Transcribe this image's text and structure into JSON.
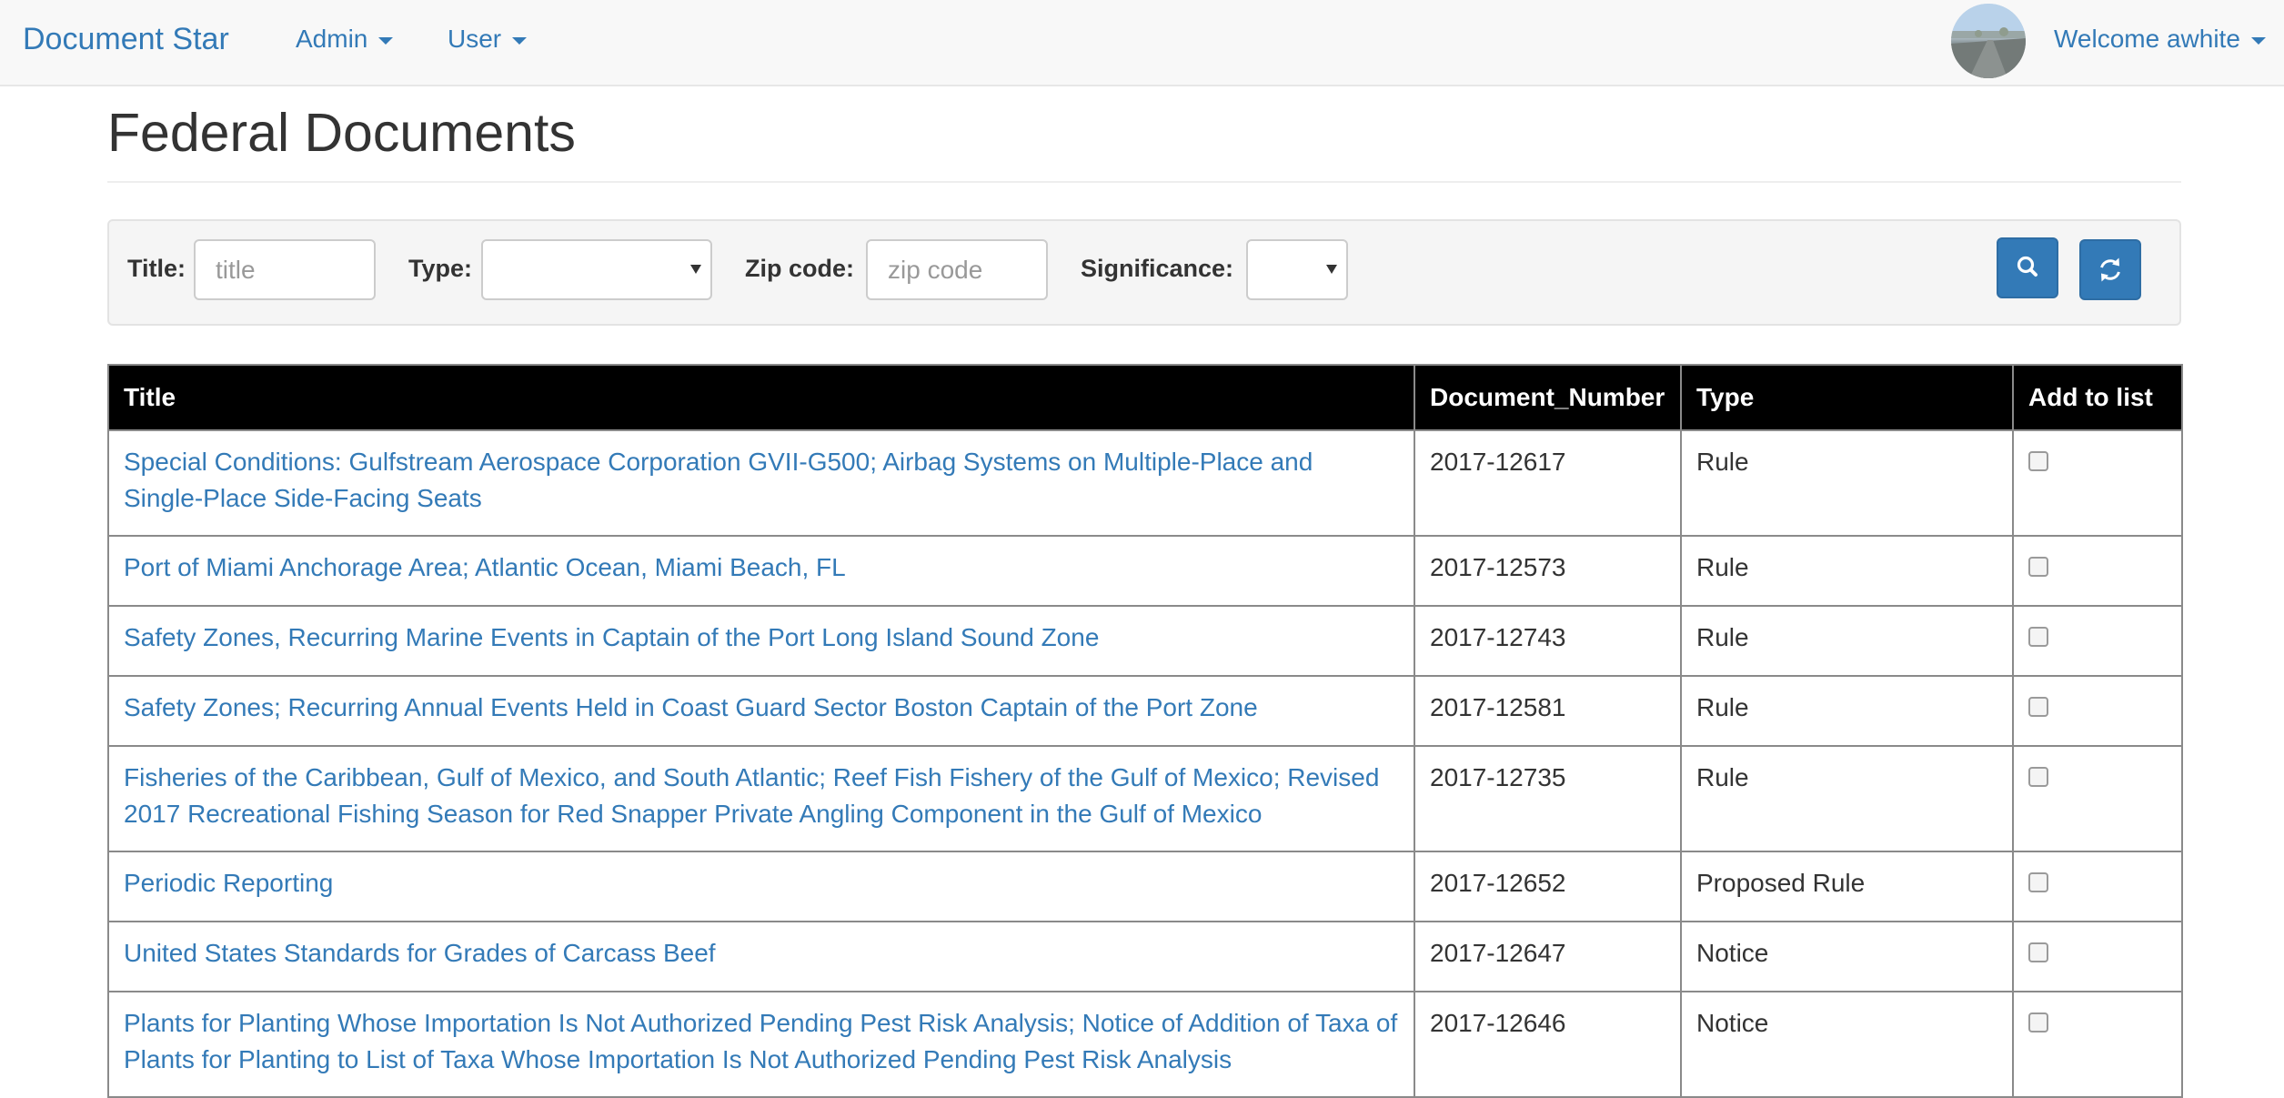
{
  "navbar": {
    "brand": "Document Star",
    "admin_label": "Admin",
    "user_label": "User",
    "welcome_label": "Welcome awhite"
  },
  "page": {
    "title": "Federal Documents"
  },
  "filters": {
    "title_label": "Title:",
    "title_placeholder": "title",
    "title_value": "",
    "type_label": "Type:",
    "type_value": "",
    "zip_label": "Zip code:",
    "zip_placeholder": "zip code",
    "zip_value": "",
    "significance_label": "Significance:",
    "significance_value": ""
  },
  "table": {
    "headers": {
      "title": "Title",
      "document_number": "Document_Number",
      "type": "Type",
      "add_to_list": "Add to list"
    },
    "rows": [
      {
        "title": "Special Conditions: Gulfstream Aerospace Corporation GVII-G500; Airbag Systems on Multiple-Place and Single-Place Side-Facing Seats",
        "number": "2017-12617",
        "type": "Rule",
        "checked": false
      },
      {
        "title": "Port of Miami Anchorage Area; Atlantic Ocean, Miami Beach, FL",
        "number": "2017-12573",
        "type": "Rule",
        "checked": false
      },
      {
        "title": "Safety Zones, Recurring Marine Events in Captain of the Port Long Island Sound Zone",
        "number": "2017-12743",
        "type": "Rule",
        "checked": false
      },
      {
        "title": "Safety Zones; Recurring Annual Events Held in Coast Guard Sector Boston Captain of the Port Zone",
        "number": "2017-12581",
        "type": "Rule",
        "checked": false
      },
      {
        "title": "Fisheries of the Caribbean, Gulf of Mexico, and South Atlantic; Reef Fish Fishery of the Gulf of Mexico; Revised 2017 Recreational Fishing Season for Red Snapper Private Angling Component in the Gulf of Mexico",
        "number": "2017-12735",
        "type": "Rule",
        "checked": false
      },
      {
        "title": "Periodic Reporting",
        "number": "2017-12652",
        "type": "Proposed Rule",
        "checked": false
      },
      {
        "title": "United States Standards for Grades of Carcass Beef",
        "number": "2017-12647",
        "type": "Notice",
        "checked": false
      },
      {
        "title": "Plants for Planting Whose Importation Is Not Authorized Pending Pest Risk Analysis; Notice of Addition of Taxa of Plants for Planting to List of Taxa Whose Importation Is Not Authorized Pending Pest Risk Analysis",
        "number": "2017-12646",
        "type": "Notice",
        "checked": false
      }
    ]
  },
  "icons": {
    "search": "search-icon",
    "refresh": "refresh-icon",
    "caret": "caret-down-icon"
  },
  "colors": {
    "link": "#337ab7",
    "button": "#337ab7",
    "header_bg": "#000000",
    "navbar_bg": "#f8f8f8"
  }
}
